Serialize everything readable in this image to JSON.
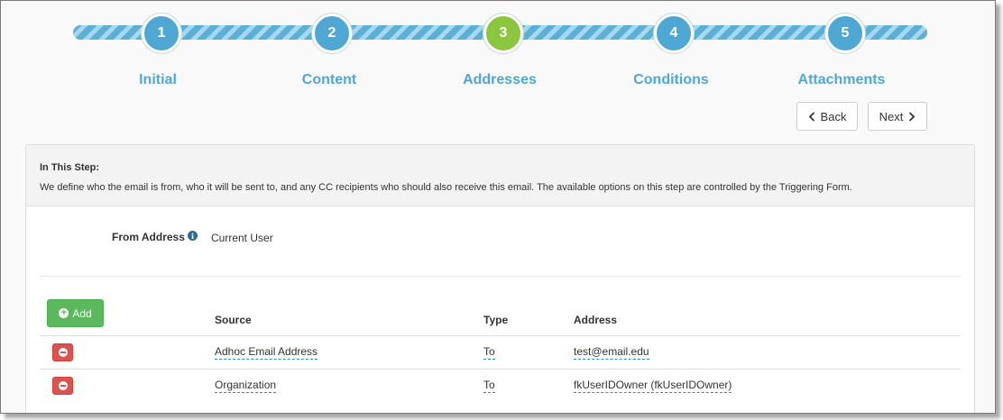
{
  "wizard": {
    "steps": [
      {
        "number": "1",
        "label": "Initial",
        "active": false
      },
      {
        "number": "2",
        "label": "Content",
        "active": false
      },
      {
        "number": "3",
        "label": "Addresses",
        "active": true
      },
      {
        "number": "4",
        "label": "Conditions",
        "active": false
      },
      {
        "number": "5",
        "label": "Attachments",
        "active": false
      }
    ],
    "back_label": "Back",
    "next_label": "Next"
  },
  "panel": {
    "header_title": "In This Step:",
    "header_desc": "We define who the email is from, who it will be sent to, and any CC recipients who should also receive this email. The available options on this step are controlled by the Triggering Form."
  },
  "from": {
    "label": "From Address",
    "value": "Current User"
  },
  "recipients": {
    "add_label": "Add",
    "columns": [
      "Source",
      "Type",
      "Address"
    ],
    "rows": [
      {
        "source": "Adhoc Email Address",
        "type": "To",
        "address": "test@email.edu"
      },
      {
        "source": "Organization",
        "type": "To",
        "address": "fkUserIDOwner (fkUserIDOwner)"
      }
    ]
  },
  "colors": {
    "step_blue": "#4fa8d3",
    "step_active_green": "#8cc63f",
    "add_green": "#5cb85c",
    "delete_red": "#d9534f",
    "link_blue": "#2a8bc9"
  }
}
